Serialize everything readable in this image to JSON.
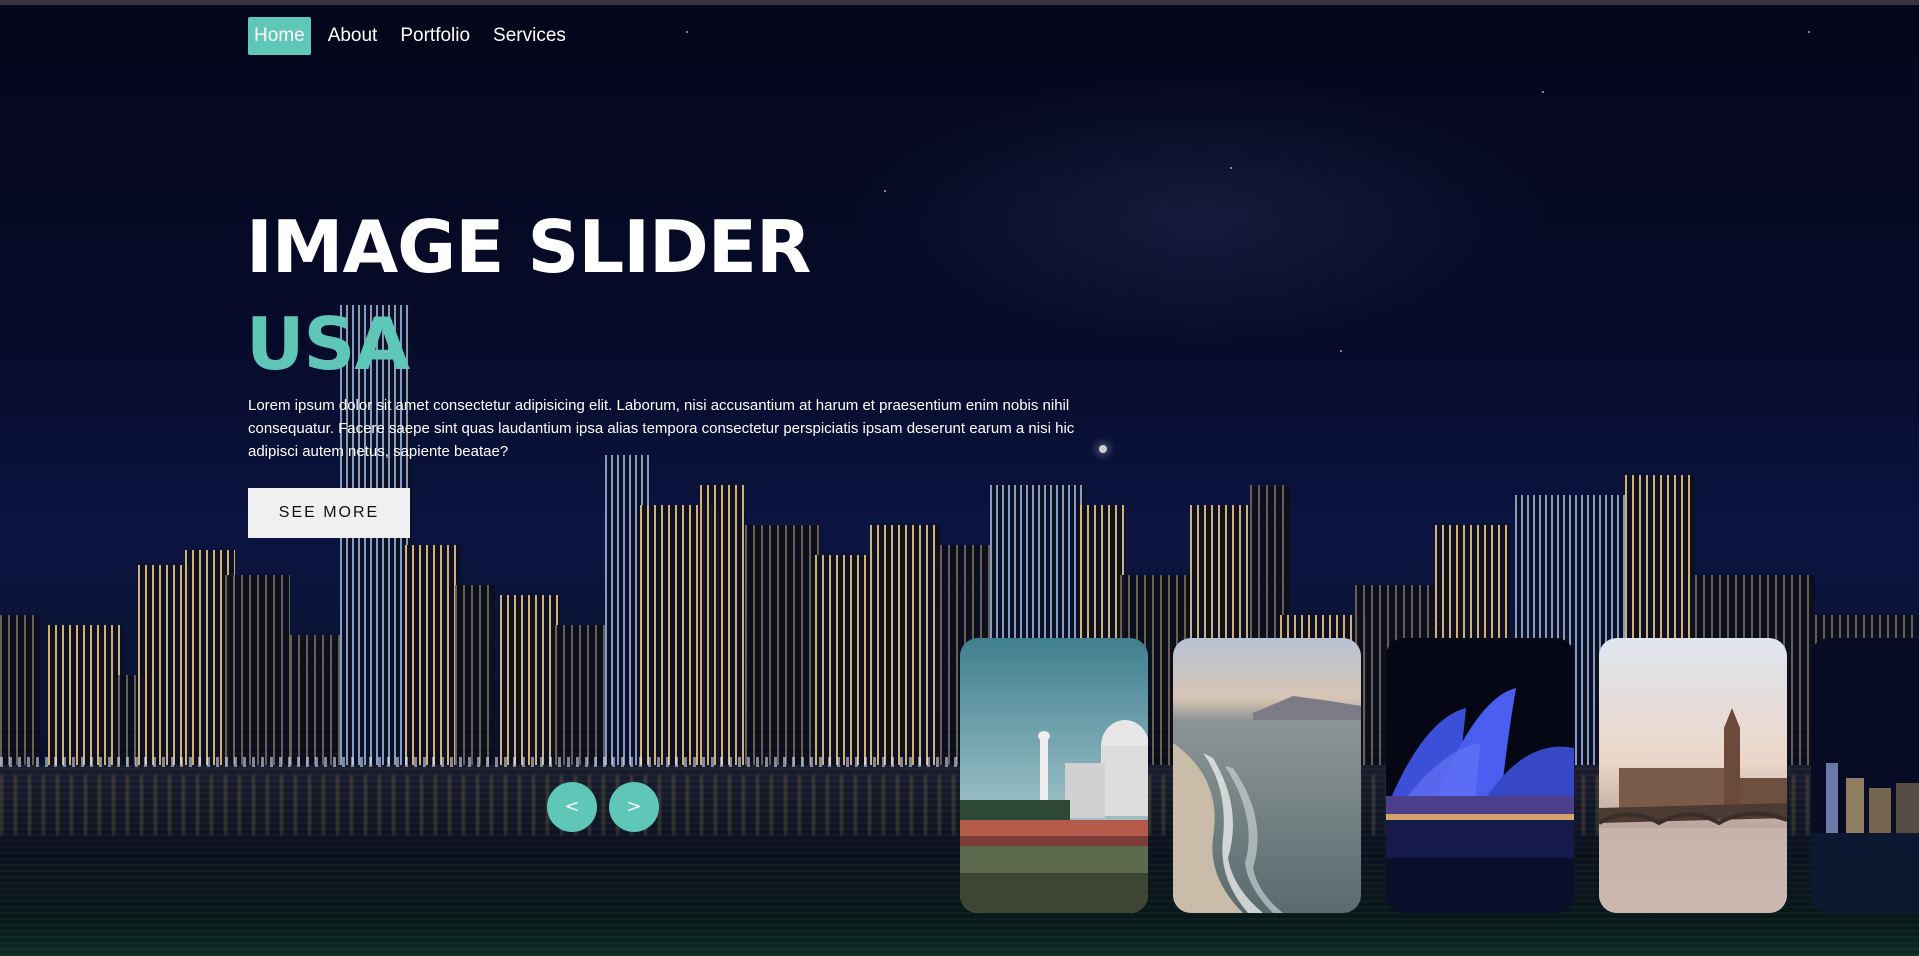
{
  "nav": {
    "items": [
      "Home",
      "About",
      "Portfolio",
      "Services"
    ],
    "active": "Home"
  },
  "hero": {
    "title": "IMAGE SLIDER",
    "subtitle": "USA",
    "description": "Lorem ipsum dolor sit amet consectetur adipisicing elit. Laborum, nisi accusantium at harum et praesentium enim nobis nihil consequatur. Facere saepe sint quas laudantium ipsa alias tempora consectetur perspiciatis ipsam deserunt earum a nisi hic adipisci autem netus, sapiente beatae?",
    "button_label": "SEE MORE"
  },
  "slider": {
    "prev_label": "<",
    "next_label": ">"
  },
  "theme": {
    "accent": "#5ec7b8",
    "text": "#ffffff",
    "button_bg": "#f0f0f0"
  }
}
